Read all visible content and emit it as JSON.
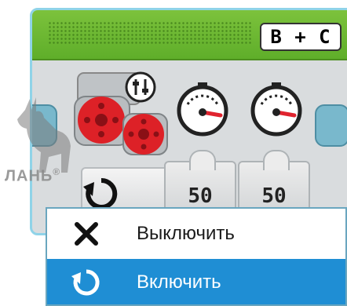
{
  "block": {
    "port": "B + C",
    "mode_icon": "steering-motor-icon",
    "settings_icon": "sliders-icon",
    "inputs": [
      {
        "icon": "speedometer-icon",
        "value": "50"
      },
      {
        "icon": "speedometer-icon",
        "value": "50"
      }
    ],
    "mode_selector_icon": "rotate-icon"
  },
  "menu": {
    "items": [
      {
        "label": "Выключить",
        "icon": "close-icon",
        "selected": false
      },
      {
        "label": "Включить",
        "icon": "rotate-icon",
        "selected": true
      }
    ],
    "selected_color": "#1f8ed4"
  },
  "watermark": {
    "text": "ЛАНЬ",
    "mark": "®"
  },
  "colors": {
    "header": "#6ab832",
    "block_border": "#8fd3e8",
    "accent_red": "#e0232e"
  }
}
